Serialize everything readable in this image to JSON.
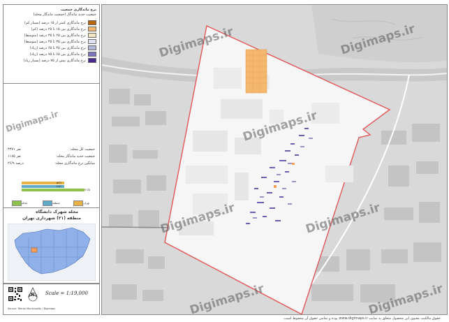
{
  "legend": {
    "title": "نرخ ماندگاری جمعیت",
    "subtitle": "جمعیت جدید ماندگار (جمعیت ماندگار محله)",
    "items": [
      {
        "label": "نرخ ماندگاری کمتر از ۱۵ درصد (بسیار کم)",
        "color": "#b8650e"
      },
      {
        "label": "نرخ ماندگاری بین ۱۵ تا ۲۵ درصد (کم)",
        "color": "#f4b76e"
      },
      {
        "label": "نرخ ماندگاری بین ۲۵ تا ۳۵ درصد (متوسط)",
        "color": "#f3e7c4"
      },
      {
        "label": "نرخ ماندگاری بین ۳۵ تا ۴۵ درصد (متوسط)",
        "color": "#dfe2f0"
      },
      {
        "label": "نرخ ماندگاری بین ۴۵ تا ۶۵ درصد (زیاد)",
        "color": "#b4b7dc"
      },
      {
        "label": "نرخ ماندگاری بین ۶۵ تا ۷۵ درصد (زیاد)",
        "color": "#7d75bd"
      },
      {
        "label": "نرخ ماندگاری بیش از ۷۵ درصد (بسیار زیاد)",
        "color": "#4a2a8f"
      }
    ]
  },
  "stats": [
    {
      "label": "جمعیت کل محله:",
      "value": "۴۳۷۱ نفر"
    },
    {
      "label": "جمعیت جدید ماندگار محله:",
      "value": "۱۱۷۵ نفر"
    },
    {
      "label": "میانگین نرخ ماندگاری محله:",
      "value": "۲۶/۹ درصد"
    }
  ],
  "bars": [
    {
      "label": "تهران",
      "fraction": 0.62,
      "color": "#e9b143"
    },
    {
      "label": "منطقه",
      "fraction": 0.62,
      "color": "#5fa8c7"
    },
    {
      "label": "محله",
      "fraction": 0.92,
      "color": "#8cc24a"
    }
  ],
  "bar_values": [
    "۵۳/۱",
    "۴۸/۱",
    "۷۱/۵"
  ],
  "pills": [
    {
      "label": "تهران",
      "color": "#e9b143"
    },
    {
      "label": "منطقه",
      "color": "#5fa8c7"
    },
    {
      "label": "محله",
      "color": "#8cc24a"
    }
  ],
  "locator": {
    "title": "محله شهرک دانشگاه",
    "subtitle": "منطقه (۲۱) شهرداری تهران"
  },
  "scale": "Scale = 1:19,000",
  "north": "N",
  "credit": "Source: Tehran Municipality / Digimaps",
  "watermark": "Digimaps.ir",
  "footer": "حقوق مالکیت معنوی این محصول متعلق به سایت www.digimaps.ir بوده و تمامی حقوق آن محفوظ است."
}
